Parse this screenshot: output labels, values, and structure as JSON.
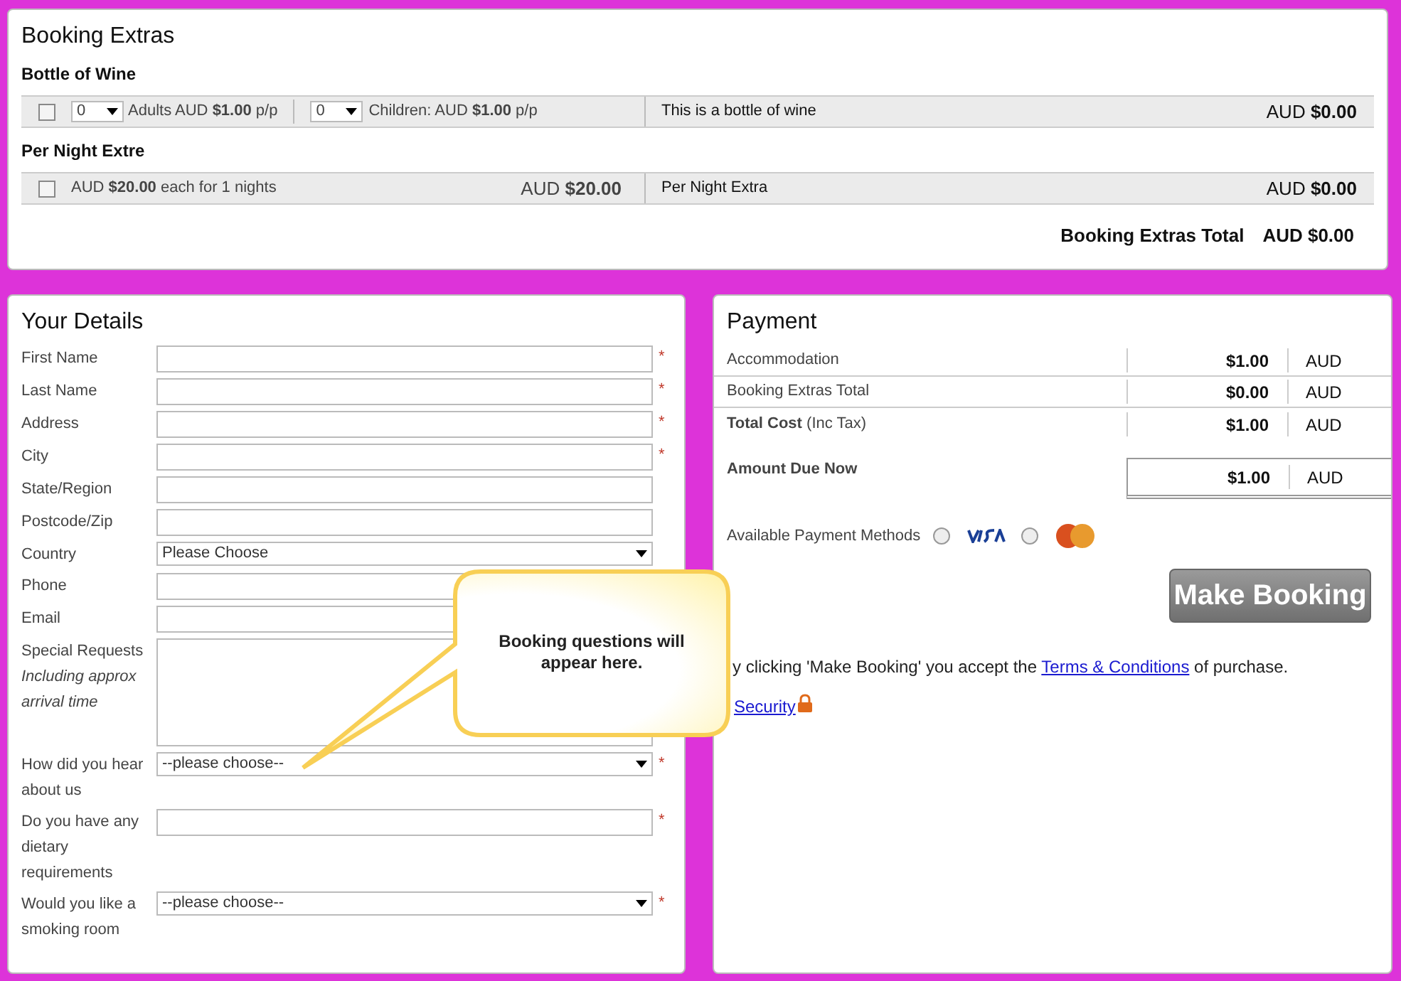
{
  "booking_extras": {
    "title": "Booking Extras",
    "items": [
      {
        "kind": "per_person",
        "heading": "Bottle of Wine",
        "checked": false,
        "adults": {
          "value": "0",
          "label": "Adults AUD **$1.00** p/p"
        },
        "children": {
          "value": "0",
          "label": "Children: AUD **$1.00** p/p"
        },
        "description": "This is a bottle of wine",
        "total": "AUD **$0.00**"
      },
      {
        "kind": "per_night",
        "heading": "Per Night Extre",
        "checked": false,
        "detail": "AUD **$20.00** each for 1 nights",
        "price": "AUD **$20.00**",
        "description": "Per Night Extra",
        "total": "AUD **$0.00**"
      }
    ],
    "total_label": "Booking Extras Total",
    "total_value": "AUD $0.00"
  },
  "details": {
    "title": "Your Details",
    "fields": [
      {
        "kind": "text",
        "label": "First Name",
        "required_mark": "*"
      },
      {
        "kind": "text",
        "label": "Last Name",
        "required_mark": "*"
      },
      {
        "kind": "text",
        "label": "Address",
        "required_mark": "*"
      },
      {
        "kind": "text",
        "label": "City",
        "required_mark": "*"
      },
      {
        "kind": "text",
        "label": "State/Region"
      },
      {
        "kind": "text",
        "label": "Postcode/Zip"
      },
      {
        "kind": "select",
        "label": "Country",
        "value": "Please Choose"
      },
      {
        "kind": "text",
        "label": "Phone"
      },
      {
        "kind": "text",
        "label": "Email"
      },
      {
        "kind": "textarea",
        "label": "Special Requests",
        "note": "Including approx arrival time"
      },
      {
        "kind": "select",
        "label": "How did you hear about us",
        "value": "--please choose--",
        "required_mark": "*"
      },
      {
        "kind": "text",
        "label": "Do you have any dietary requirements",
        "required_mark": "*"
      },
      {
        "kind": "select",
        "label": "Would you like a smoking room",
        "value": "--please choose--",
        "required_mark": "*"
      }
    ]
  },
  "callout": {
    "text": "Booking questions will appear here."
  },
  "payment": {
    "title": "Payment",
    "rows": [
      {
        "label": "Accommodation",
        "price": "$1.00",
        "currency": "AUD"
      },
      {
        "label": "Booking Extras Total",
        "price": "$0.00",
        "currency": "AUD"
      },
      {
        "label": "**Total Cost** (Inc Tax)",
        "price": "$1.00",
        "currency": "AUD"
      }
    ],
    "amount_due": {
      "label": "Amount Due Now",
      "price": "$1.00",
      "currency": "AUD"
    },
    "methods_label": "Available Payment Methods",
    "methods": [
      {
        "kind": "visa",
        "selected": false
      },
      {
        "kind": "mastercard",
        "selected": false
      }
    ],
    "button": "Make Booking",
    "terms": {
      "before": "y clicking 'Make Booking' you accept the",
      "link": "Terms & Conditions",
      "after": "of purchase."
    },
    "security": "Security"
  }
}
